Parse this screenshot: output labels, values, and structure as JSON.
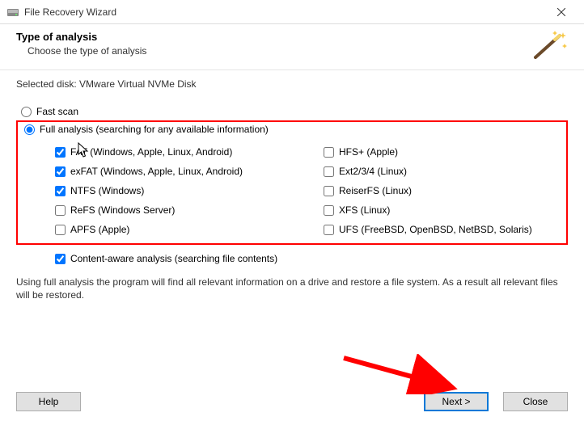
{
  "window": {
    "title": "File Recovery Wizard"
  },
  "header": {
    "title": "Type of analysis",
    "subtitle": "Choose the type of analysis"
  },
  "selectedDisk": {
    "prefix": "Selected disk: ",
    "name": "VMware Virtual NVMe Disk"
  },
  "scanModes": {
    "fast": {
      "label": "Fast scan",
      "selected": false
    },
    "full": {
      "label": "Full analysis (searching for any available information)",
      "selected": true
    }
  },
  "fsLeft": [
    {
      "label": "FAT (Windows, Apple, Linux, Android)",
      "checked": true
    },
    {
      "label": "exFAT (Windows, Apple, Linux, Android)",
      "checked": true
    },
    {
      "label": "NTFS (Windows)",
      "checked": true
    },
    {
      "label": "ReFS (Windows Server)",
      "checked": false
    },
    {
      "label": "APFS (Apple)",
      "checked": false
    }
  ],
  "fsRight": [
    {
      "label": "HFS+ (Apple)",
      "checked": false
    },
    {
      "label": "Ext2/3/4 (Linux)",
      "checked": false
    },
    {
      "label": "ReiserFS (Linux)",
      "checked": false
    },
    {
      "label": "XFS (Linux)",
      "checked": false
    },
    {
      "label": "UFS (FreeBSD, OpenBSD, NetBSD, Solaris)",
      "checked": false
    }
  ],
  "contentAware": {
    "label": "Content-aware analysis (searching file contents)",
    "checked": true
  },
  "description": "Using full analysis the program will find all relevant information on a drive and restore a file system. As a result all relevant files will be restored.",
  "buttons": {
    "help": "Help",
    "next": "Next >",
    "close": "Close"
  }
}
